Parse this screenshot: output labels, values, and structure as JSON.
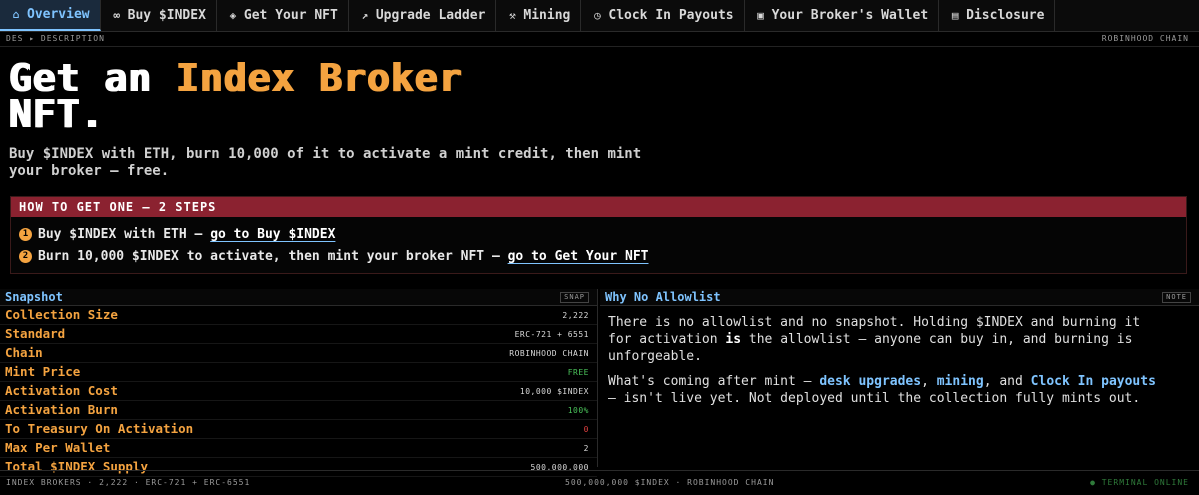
{
  "nav": {
    "items": [
      {
        "label": "Overview",
        "icon": "home-icon"
      },
      {
        "label": "Buy $INDEX",
        "icon": "link-icon"
      },
      {
        "label": "Get Your NFT",
        "icon": "gem-icon"
      },
      {
        "label": "Upgrade Ladder",
        "icon": "trend-icon"
      },
      {
        "label": "Mining",
        "icon": "pickaxe-icon"
      },
      {
        "label": "Clock In Payouts",
        "icon": "clock-icon"
      },
      {
        "label": "Your Broker's Wallet",
        "icon": "wallet-icon"
      },
      {
        "label": "Disclosure",
        "icon": "document-icon"
      }
    ],
    "active_index": 0
  },
  "subheader": {
    "left": "DES ▸ DESCRIPTION",
    "right": "ROBINHOOD CHAIN"
  },
  "hero": {
    "title_part1": "Get an ",
    "title_highlight": "Index Broker",
    "title_part2": "NFT.",
    "subtitle": "Buy $INDEX with ETH, burn 10,000 of it to activate a mint credit, then mint your broker — free."
  },
  "steps": {
    "heading": "HOW TO GET ONE — 2 STEPS",
    "items": [
      {
        "num": "1",
        "text": "Buy $INDEX with ETH — ",
        "link": "go to Buy $INDEX"
      },
      {
        "num": "2",
        "text": "Burn 10,000 $INDEX to activate, then mint your broker NFT — ",
        "link": "go to Get Your NFT"
      }
    ]
  },
  "snapshot": {
    "title": "Snapshot",
    "tag": "SNAP",
    "rows": [
      {
        "key": "Collection Size",
        "value": "2,222"
      },
      {
        "key": "Standard",
        "value": "ERC-721 + 6551"
      },
      {
        "key": "Chain",
        "value": "ROBINHOOD CHAIN"
      },
      {
        "key": "Mint Price",
        "value": "FREE"
      },
      {
        "key": "Activation Cost",
        "value": "10,000 $INDEX"
      },
      {
        "key": "Activation Burn",
        "value": "100%"
      },
      {
        "key": "To Treasury On Activation",
        "value": "0"
      },
      {
        "key": "Max Per Wallet",
        "value": "2"
      },
      {
        "key": "Total $INDEX Supply",
        "value": "500,000,000"
      }
    ],
    "colors": {
      "free": "#4ac25a",
      "burn": "#4ac25a",
      "treasury": "#e04040"
    }
  },
  "why": {
    "title": "Why No Allowlist",
    "tag": "NOTE",
    "p1_a": "There is no allowlist and no snapshot. Holding $INDEX and burning it for activation ",
    "p1_b": "is",
    "p1_c": " the allowlist — anyone can buy in, and burning is unforgeable.",
    "p2_a": "What's coming after mint — ",
    "p2_link1": "desk upgrades",
    "p2_b": ", ",
    "p2_link2": "mining",
    "p2_c": ", and ",
    "p2_link3": "Clock In payouts",
    "p2_d": " — isn't live yet. Not deployed until the collection fully mints out."
  },
  "footer": {
    "left": "INDEX BROKERS · 2,222 · ERC-721 + ERC-6551",
    "center": "500,000,000 $INDEX · ROBINHOOD CHAIN",
    "right": "● TERMINAL ONLINE"
  },
  "colors": {
    "accent": "#f4a340",
    "link": "#7fc4ff",
    "banner": "#8b2230",
    "online": "#2f7a3a"
  }
}
